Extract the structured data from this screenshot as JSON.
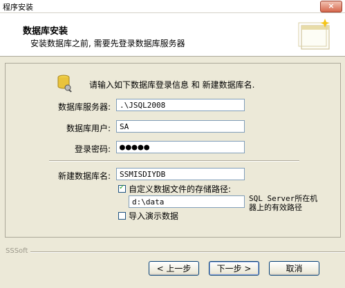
{
  "window": {
    "title": "程序安装",
    "close_label": "×"
  },
  "header": {
    "title": "数据库安装",
    "subtitle": "安装数据库之前, 需要先登录数据库服务器"
  },
  "intro_text": "请输入如下数据库登录信息 和 新建数据库名.",
  "form": {
    "server_label": "数据库服务器:",
    "server_value": ".\\JSQL2008",
    "user_label": "数据库用户:",
    "user_value": "SA",
    "password_label": "登录密码:",
    "password_value": "●●●●●",
    "newdb_label": "新建数据库名:",
    "newdb_value": "SSMISDIYDB",
    "custom_path_label": "自定义数据文件的存储路径:",
    "custom_path_checked": true,
    "path_value": "d:\\data",
    "path_note": "SQL Server所在机器上的有效路径",
    "import_demo_label": "导入演示数据",
    "import_demo_checked": false
  },
  "footer": {
    "brand": "SSSoft",
    "back_label": "< 上一步",
    "next_label": "下一步 >",
    "cancel_label": "取消"
  },
  "icons": {
    "header": "wizard-icon",
    "intro": "database-icon"
  }
}
